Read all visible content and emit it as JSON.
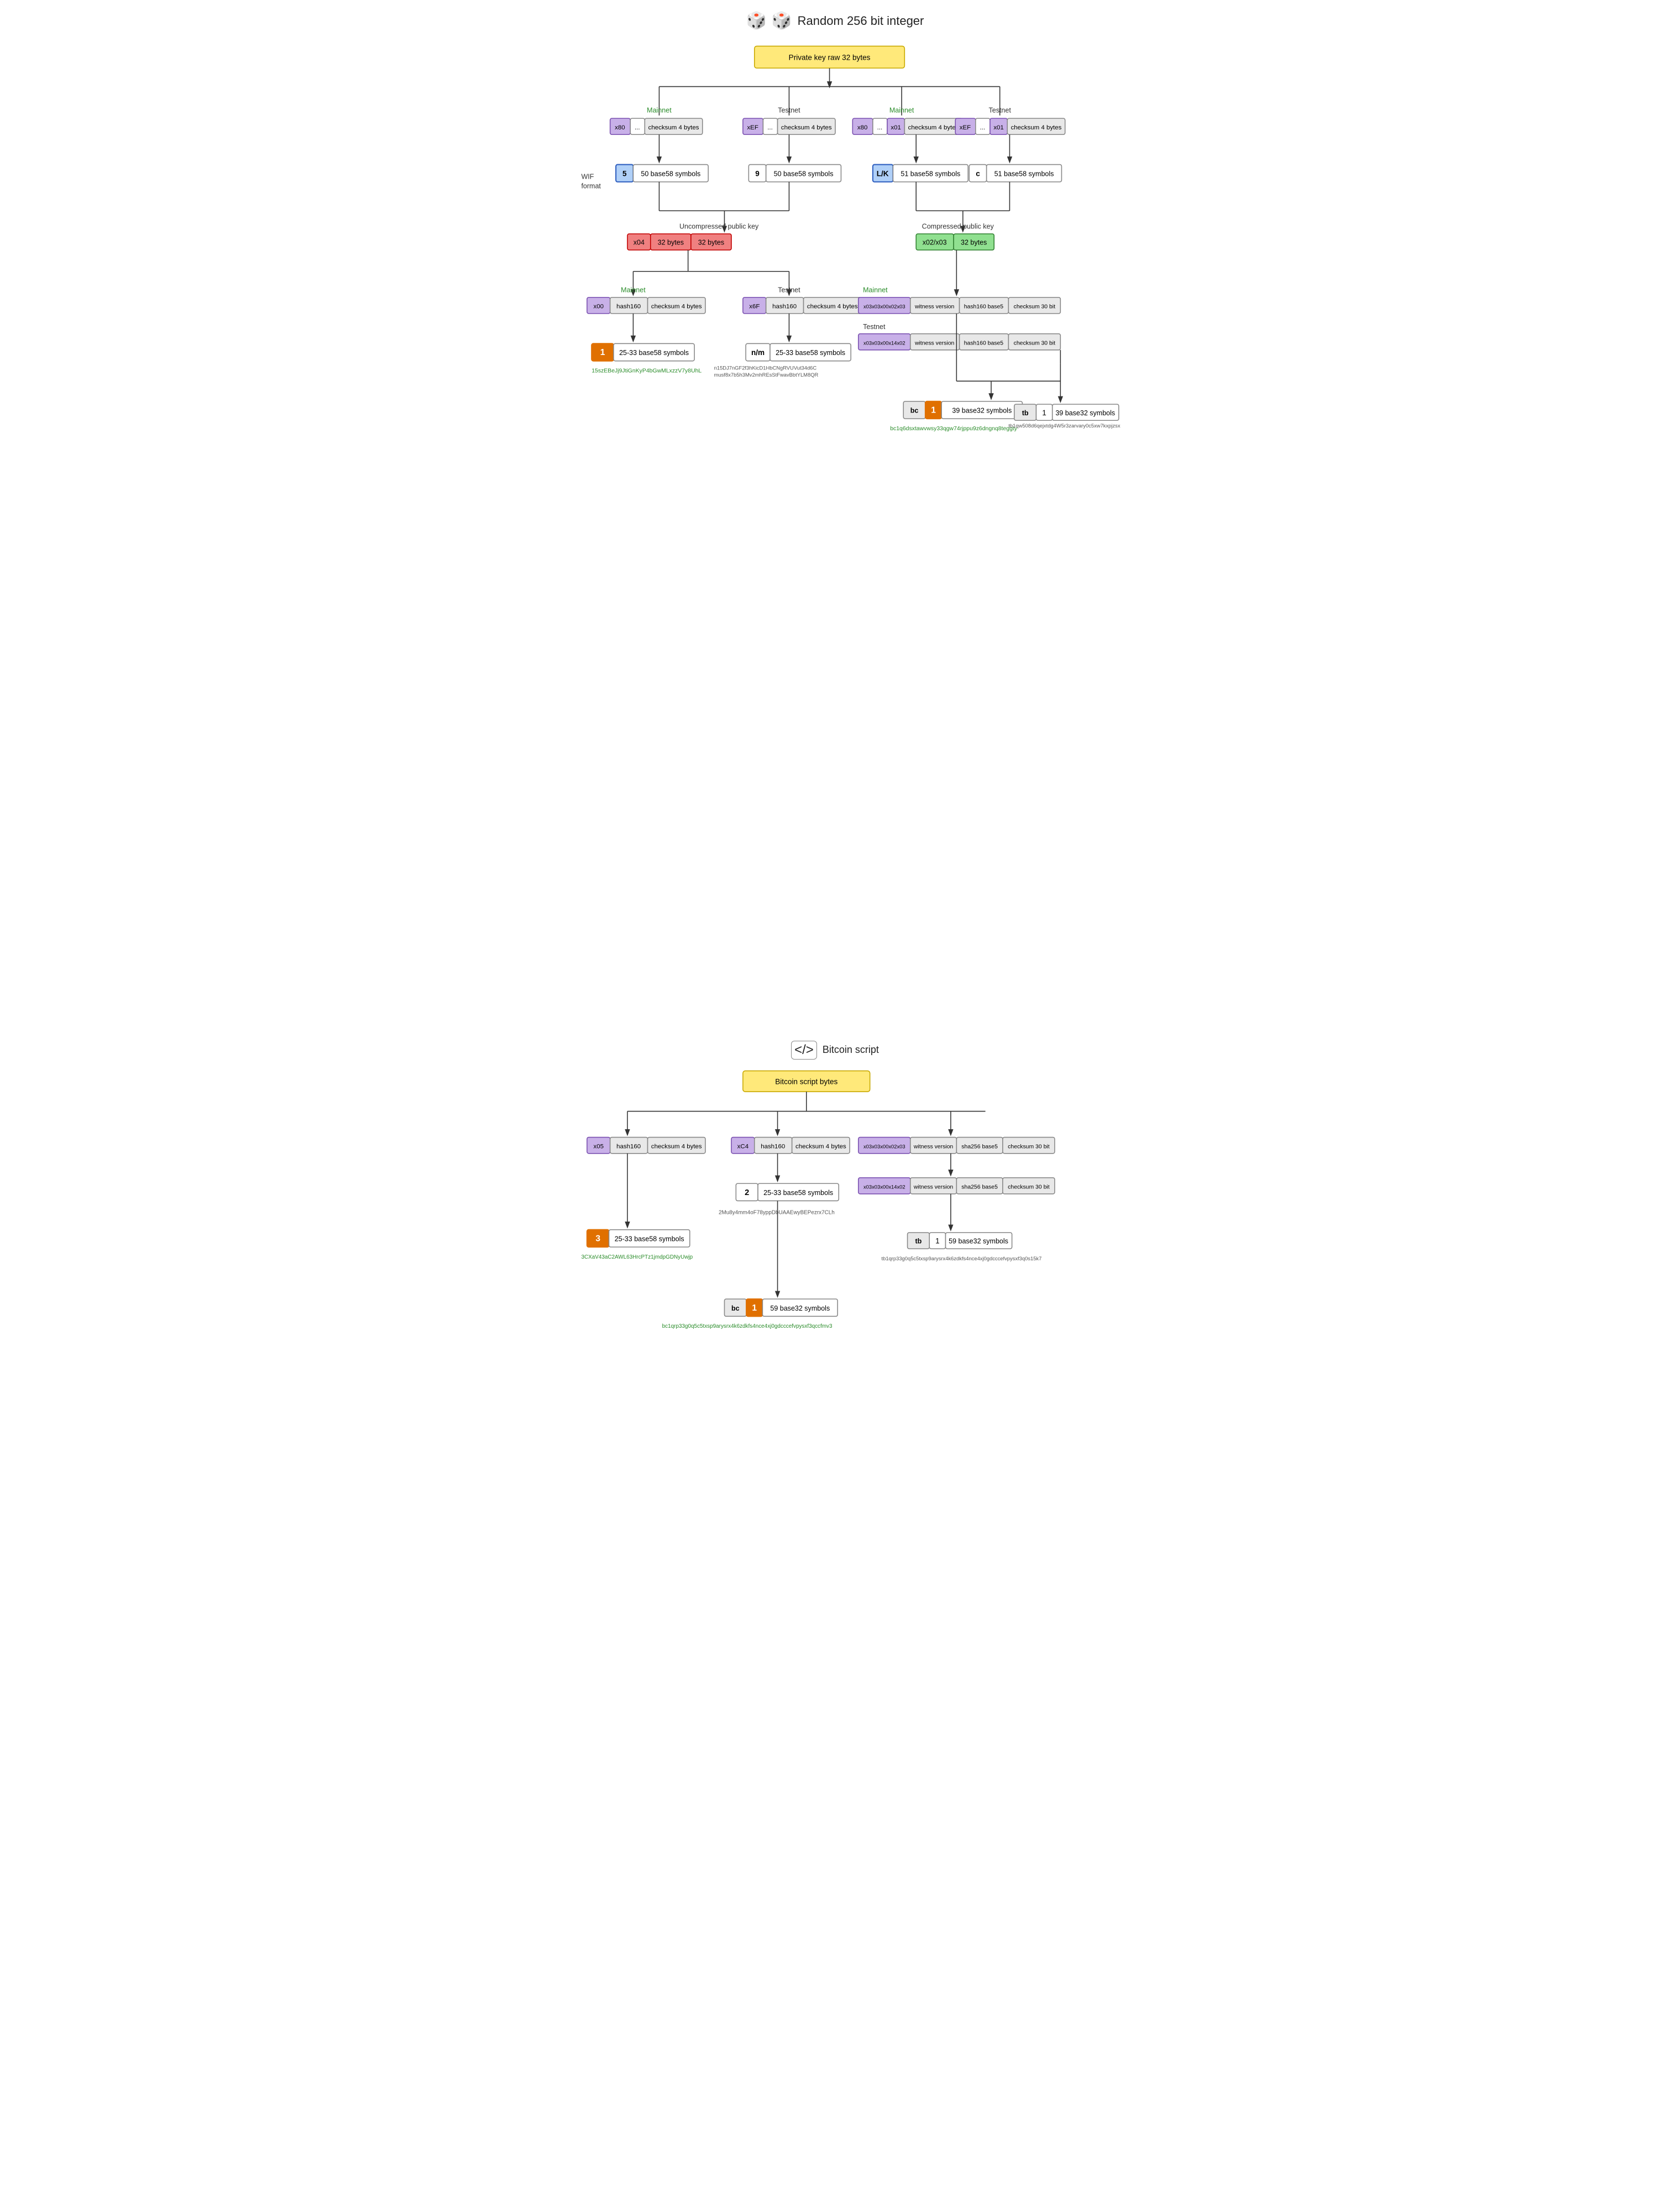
{
  "header": {
    "title": "Random 256 bit integer",
    "dice_icon": "🎲"
  },
  "section1": {
    "title": "Private key raw 32 bytes",
    "top_box_label": "Private key raw 32 bytes"
  },
  "wif": {
    "label": "WIF format",
    "mainnet_label": "Mainnet",
    "testnet_label": "Testnet",
    "mainnet_row": [
      "x80",
      "...",
      "checksum 4 bytes"
    ],
    "testnet_row": [
      "xEF",
      "...",
      "checksum 4 bytes"
    ],
    "mainnet_compressed_row": [
      "x80",
      "...",
      "x01",
      "checksum 4 bytes"
    ],
    "testnet_compressed_row": [
      "xEF",
      "...",
      "x01",
      "checksum 4 bytes"
    ],
    "wif_uncompressed_mainnet": [
      "5",
      "50 base58 symbols"
    ],
    "wif_uncompressed_testnet": [
      "9",
      "50 base58 symbols"
    ],
    "wif_compressed_mainnet": [
      "L/K",
      "51 base58 symbols"
    ],
    "wif_compressed_testnet": [
      "c",
      "51 base58 symbols"
    ]
  },
  "pubkey": {
    "uncompressed_label": "Uncompressed public key",
    "compressed_label": "Compressed public key",
    "uncompressed_row": [
      "x04",
      "32 bytes",
      "32 bytes"
    ],
    "compressed_row": [
      "x02/x03",
      "32 bytes"
    ]
  },
  "p2pkh": {
    "mainnet_label": "Mainnet",
    "testnet_label": "Testnet",
    "mainnet_row": [
      "x00",
      "hash160",
      "checksum 4 bytes"
    ],
    "testnet_row": [
      "x6F",
      "hash160",
      "checksum 4 bytes"
    ],
    "mainnet_result": [
      "1",
      "25-33 base58 symbols"
    ],
    "testnet_result": [
      "n/m",
      "25-33 base58 symbols"
    ],
    "mainnet_addr": "15szEBeJj9JtiGnKyP4bGwMLxzzV7y8UhL",
    "testnet_addr": "n15DJ7nGF2f3hKicD1HbCNgRVUVut34d6C\nmusf8x7b5h3Mv2mhREsStFwavBbtYLM8QR"
  },
  "bech32": {
    "mainnet_row": [
      "x03x03x00x02x03",
      "witness version",
      "hash160 base5",
      "checksum 30 bit"
    ],
    "testnet_row": [
      "x03x03x00x14x02",
      "witness version",
      "hash160 base5",
      "checksum 30 bit"
    ],
    "mainnet_result": [
      "bc",
      "1",
      "39 base32 symbols"
    ],
    "testnet_result": [
      "tb",
      "1",
      "39 base32 symbols"
    ],
    "mainnet_addr": "bc1q6dsxtawvwsy33qgw74rjppu9z6dngnq8teggty",
    "testnet_addr": "tb1qw508d6qejxtdg4W5r3zarvary0c5xw7kxpjzsx"
  },
  "bitcoin_script": {
    "section_title": "Bitcoin script",
    "top_box_label": "Bitcoin script bytes",
    "p2sh_mainnet_row": [
      "x05",
      "hash160",
      "checksum 4 bytes"
    ],
    "p2sh_xc4_row": [
      "xC4",
      "hash160",
      "checksum 4 bytes"
    ],
    "p2sh_mainnet_result": [
      "3",
      "25-33 base58 symbols"
    ],
    "p2sh_mainnet_addr": "3CXaV43aC2AWL63HrcPTz1jmdpGDNyUwjp",
    "p2sh_xc4_result": [
      "2",
      "25-33 base58 symbols"
    ],
    "p2sh_xc4_addr": "2Mu8y4mm4oF78yppDbUAAEwyBEPezrx7CLh",
    "bech32_mainnet_row": [
      "x03x03x00x02x03",
      "witness version",
      "sha256 base5",
      "checksum 30 bit"
    ],
    "bech32_testnet_row": [
      "x03x03x00x14x02",
      "witness version",
      "sha256 base5",
      "checksum 30 bit"
    ],
    "bech32_bc_result": [
      "bc",
      "1",
      "59 base32 symbols"
    ],
    "bech32_tb_result": [
      "tb",
      "1",
      "59 base32 symbols"
    ],
    "bech32_bc_addr": "bc1qrp33g0q5c5txsp9arysrx4k6zdkfs4nce4xj0gdcccefvpysxf3qccfmv3",
    "bech32_tb_addr": "tb1qrp33g0q5c5txsp9arysrx4k6zdkfs4nce4xj0gdcccefvpysxf3q0s15k7"
  }
}
